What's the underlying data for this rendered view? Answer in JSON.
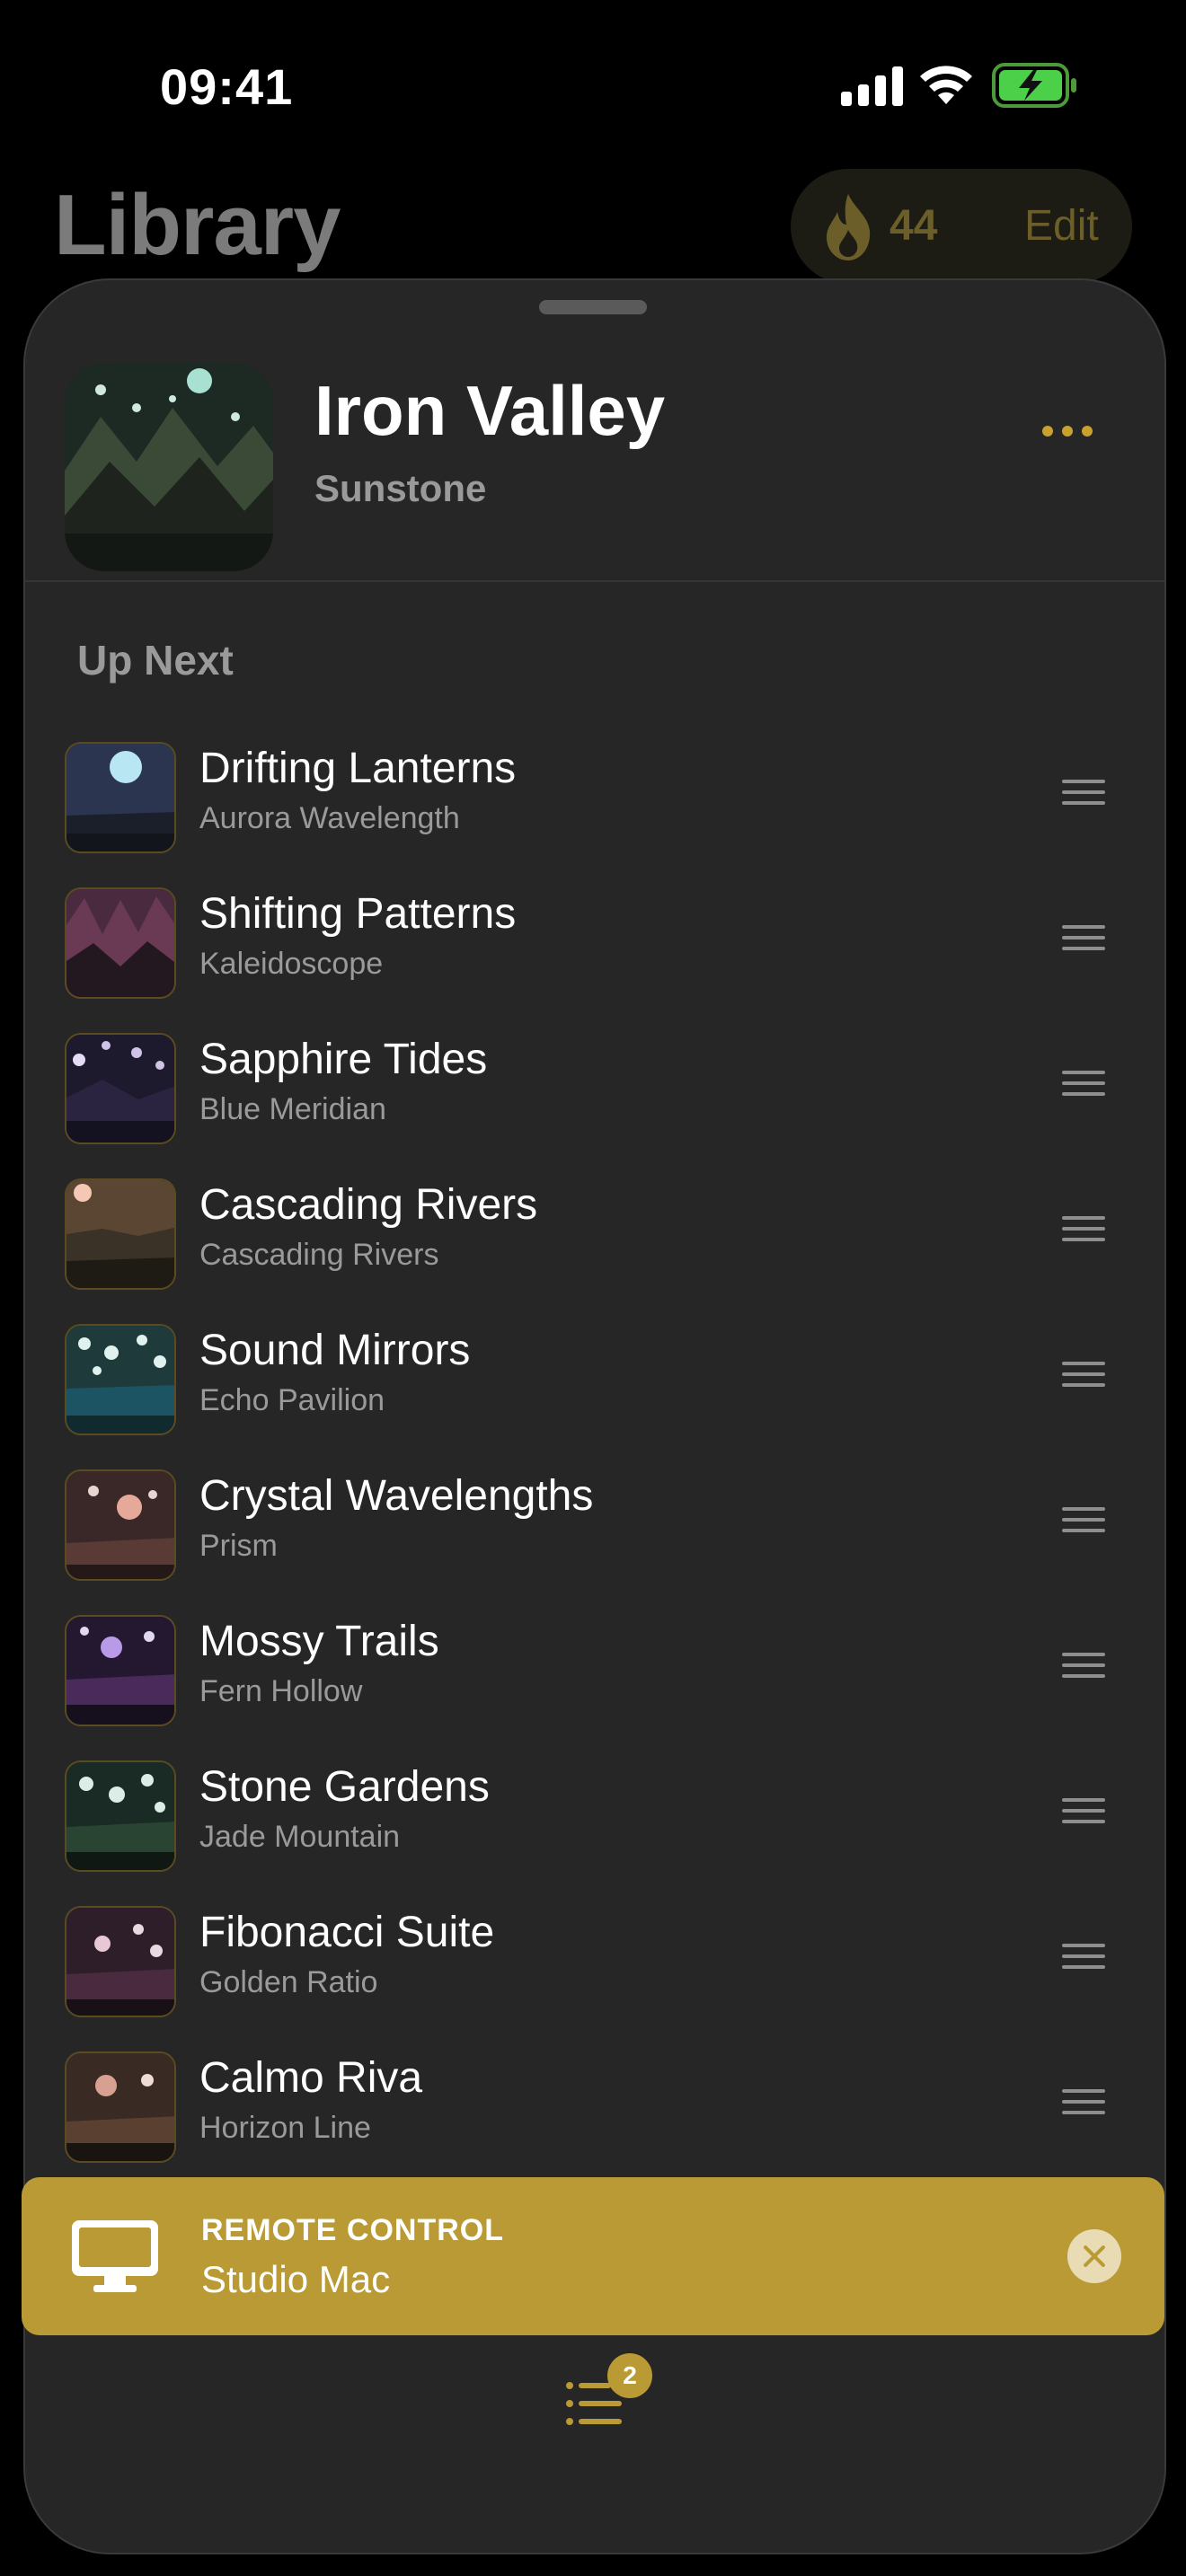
{
  "status_bar": {
    "time": "09:41"
  },
  "library": {
    "title": "Library",
    "streak_count": "44",
    "edit_label": "Edit"
  },
  "now_playing": {
    "title": "Iron Valley",
    "artist": "Sunstone",
    "more_icon": "ellipsis-icon"
  },
  "up_next": {
    "heading": "Up Next",
    "items": [
      {
        "title": "Drifting Lanterns",
        "artist": "Aurora Wavelength"
      },
      {
        "title": "Shifting Patterns",
        "artist": "Kaleidoscope"
      },
      {
        "title": "Sapphire Tides",
        "artist": "Blue Meridian"
      },
      {
        "title": "Cascading Rivers",
        "artist": "Cascading Rivers"
      },
      {
        "title": "Sound Mirrors",
        "artist": "Echo Pavilion"
      },
      {
        "title": "Crystal Wavelengths",
        "artist": "Prism"
      },
      {
        "title": "Mossy Trails",
        "artist": "Fern Hollow"
      },
      {
        "title": "Stone Gardens",
        "artist": "Jade Mountain"
      },
      {
        "title": "Fibonacci Suite",
        "artist": "Golden Ratio"
      },
      {
        "title": "Calmo Riva",
        "artist": "Horizon Line"
      }
    ]
  },
  "remote_control": {
    "label": "REMOTE CONTROL",
    "device": "Studio Mac"
  },
  "queue_button": {
    "badge": "2"
  },
  "colors": {
    "accent": "#b99a34",
    "sheet": "#262626",
    "background": "#000000"
  }
}
